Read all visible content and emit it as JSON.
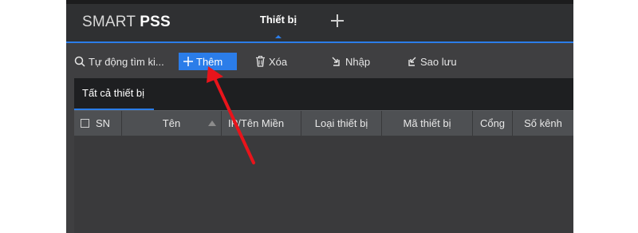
{
  "app": {
    "logo_regular": "SMART ",
    "logo_bold": "PSS",
    "active_tab_label": "Thiết bị"
  },
  "toolbar": {
    "auto_search_label": "Tự động tìm ki...",
    "add_label": "Thêm",
    "delete_label": "Xóa",
    "import_label": "Nhập",
    "backup_label": "Sao lưu"
  },
  "section": {
    "tab_label": "Tất cả thiết bị"
  },
  "table": {
    "columns": [
      "SN",
      "Tên",
      "IP/Tên Miền",
      "Loại thiết bị",
      "Mã thiết bị",
      "Cổng",
      "Số kênh"
    ]
  },
  "colors": {
    "accent": "#2b7de9",
    "annotation_arrow": "#e8141b",
    "titlebar": "#2f3032",
    "panel": "#3f3f41"
  },
  "icons": [
    "plus-icon",
    "search-icon",
    "trash-icon",
    "import-icon",
    "backup-icon",
    "sort-arrow-icon"
  ]
}
